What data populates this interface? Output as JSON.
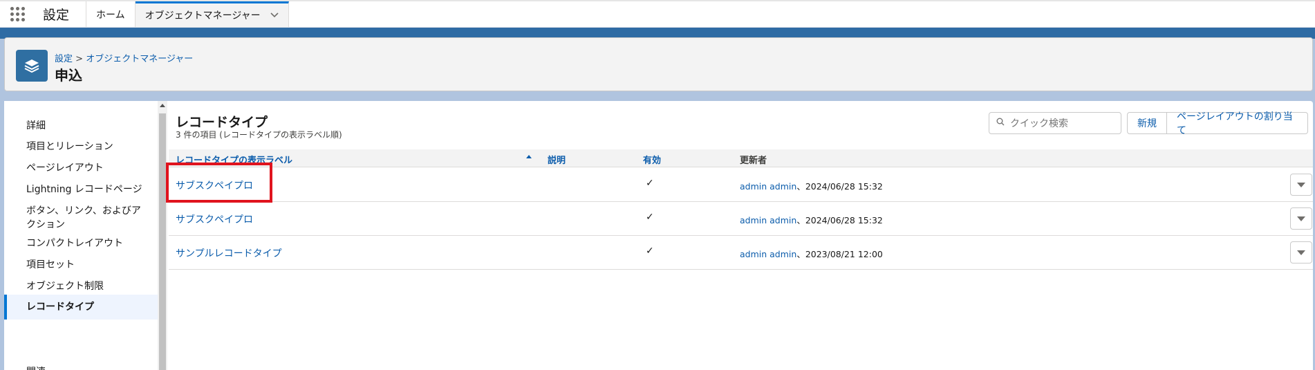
{
  "topnav": {
    "app_name": "設定",
    "tabs": [
      {
        "label": "ホーム"
      },
      {
        "label": "オブジェクトマネージャー"
      }
    ]
  },
  "header": {
    "breadcrumb_root": "設定",
    "breadcrumb_sep": ">",
    "breadcrumb_current": "オブジェクトマネージャー",
    "title": "申込"
  },
  "sidebar": {
    "items": [
      {
        "label": "詳細"
      },
      {
        "label": "項目とリレーション"
      },
      {
        "label": "ページレイアウト"
      },
      {
        "label": "Lightning レコードページ"
      },
      {
        "label": "ボタン、リンク、およびア"
      },
      {
        "label": "クション"
      },
      {
        "label": "コンパクトレイアウト"
      },
      {
        "label": "項目セット"
      },
      {
        "label": "オブジェクト制限"
      },
      {
        "label": "レコードタイプ"
      },
      {
        "label": "関連"
      }
    ]
  },
  "section": {
    "title": "レコードタイプ",
    "subtitle": "3 件の項目 (レコードタイプの表示ラベル順)",
    "search_placeholder": "クイック検索",
    "new_button": "新規",
    "assign_button": "ページレイアウトの割り当て"
  },
  "table": {
    "headers": {
      "label": "レコードタイプの表示ラベル",
      "description": "説明",
      "active": "有効",
      "modified_by": "更新者"
    },
    "rows": [
      {
        "name": "サブスクペイプロ",
        "active": "✓",
        "user": "admin admin",
        "date": "、2024/06/28 15:32"
      },
      {
        "name": "サブスクペイプロ",
        "active": "✓",
        "user": "admin admin",
        "date": "、2024/06/28 15:32"
      },
      {
        "name": "サンプルレコードタイプ",
        "active": "✓",
        "user": "admin admin",
        "date": "、2023/08/21 12:00"
      }
    ]
  },
  "colors": {
    "accent": "#0176d3",
    "link": "#0b5cab",
    "highlight": "#e0141e"
  }
}
